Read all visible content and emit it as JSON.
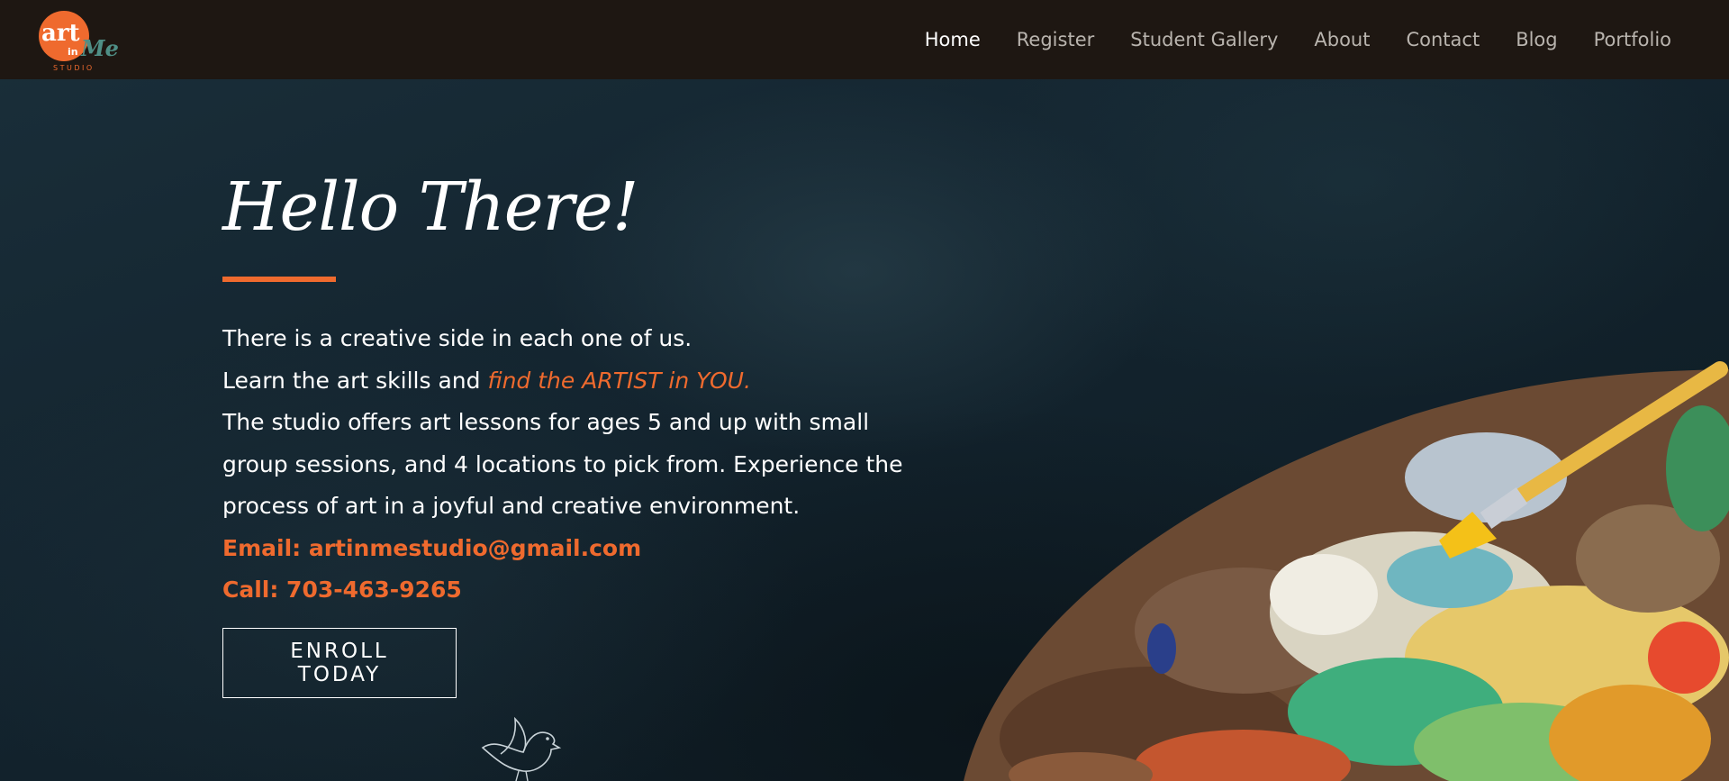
{
  "brand": {
    "logo_top": "art",
    "logo_mid": "in",
    "logo_script": "Me",
    "logo_sub": "STUDIO",
    "accent": "#ef6a2e"
  },
  "nav": {
    "items": [
      {
        "label": "Home",
        "active": true
      },
      {
        "label": "Register"
      },
      {
        "label": "Student Gallery"
      },
      {
        "label": "About"
      },
      {
        "label": "Contact"
      },
      {
        "label": "Blog"
      },
      {
        "label": "Portfolio"
      }
    ]
  },
  "hero": {
    "title": "Hello There!",
    "line1": "There is a creative side in each one of us.",
    "line2_lead": "Learn the art skills and ",
    "line2_accent": "find the ARTIST in YOU.",
    "paragraph": "The studio offers art lessons for ages 5 and up with small group sessions, and 4 locations to pick from. Experience the process of art in a joyful and creative environment.",
    "email": "Email: artinmestudio@gmail.com",
    "phone": "Call: 703-463-9265",
    "cta": "ENROLL TODAY"
  },
  "icons": {
    "logo": "art-in-me-logo",
    "palette": "paint-palette-image",
    "bird": "bird-outline-icon"
  }
}
